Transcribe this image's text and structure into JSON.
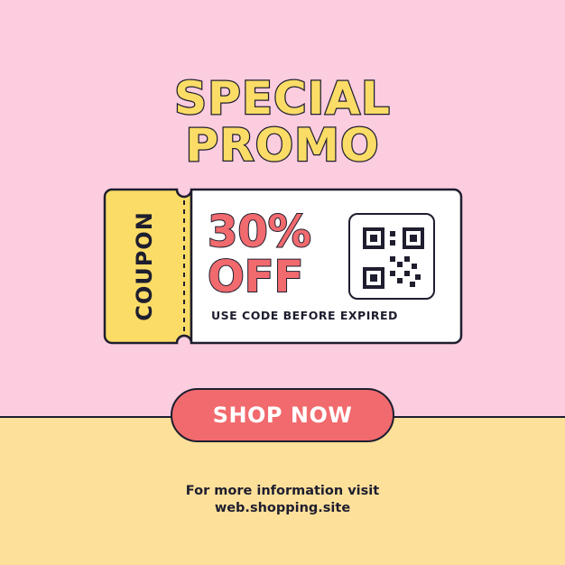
{
  "colors": {
    "top_background": "#fcccdf",
    "bottom_background": "#fde09a",
    "title_fill": "#fbdc66",
    "accent_red": "#f16a6e",
    "outline": "#1e1e2f",
    "coupon_body": "#ffffff"
  },
  "headline": {
    "line1": "SPECIAL",
    "line2": "PROMO"
  },
  "coupon": {
    "side_label": "COUPON",
    "discount_line1": "30%",
    "discount_line2": "OFF",
    "note": "USE CODE BEFORE EXPIRED",
    "qr_icon": "qr-code-icon"
  },
  "cta": {
    "label": "SHOP NOW"
  },
  "footer": {
    "line1": "For more information visit",
    "line2": "web.shopping.site"
  }
}
